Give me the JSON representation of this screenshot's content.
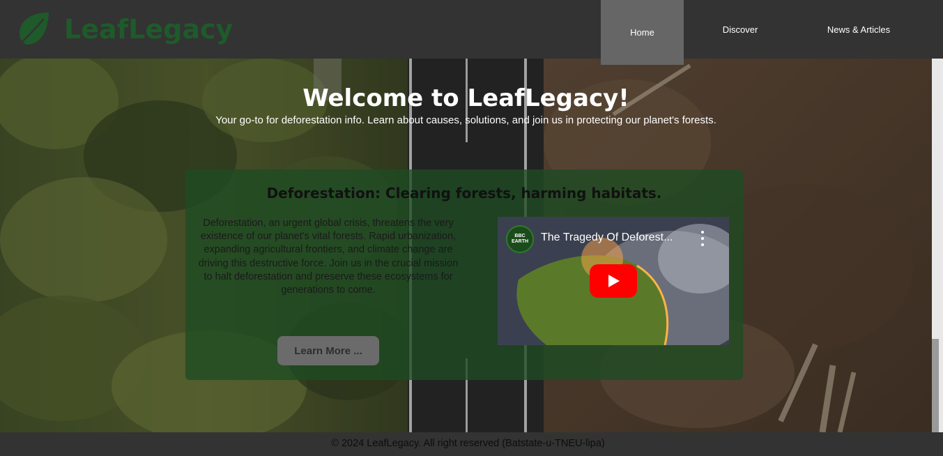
{
  "brand": {
    "name": "LeafLegacy",
    "logo_icon": "leaf-icon",
    "color": "#1e5a2a"
  },
  "nav": {
    "items": [
      {
        "label": "Home",
        "active": true
      },
      {
        "label": "Discover",
        "active": false
      },
      {
        "label": "News & Articles",
        "active": false
      }
    ]
  },
  "hero": {
    "title": "Welcome to LeafLegacy!",
    "subtitle": "Your go-to for deforestation info. Learn about causes, solutions, and join us in protecting our planet's forests."
  },
  "card": {
    "title": "Deforestation: Clearing forests, harming habitats.",
    "body": "Deforestation, an urgent global crisis, threatens the very existence of our planet's vital forests. Rapid urbanization, expanding agricultural frontiers, and climate change are driving this destructive force. Join us in the crucial mission to halt deforestation and preserve these ecosystems for generations to come.",
    "button_label": "Learn More ...",
    "video": {
      "channel_badge": "BBC EARTH",
      "title": "The Tragedy Of Deforest...",
      "play_icon": "youtube-play-icon",
      "menu_icon": "more-vert-icon"
    }
  },
  "footer": {
    "text": "© 2024 LeafLegacy. All right reserved (Batstate-u-TNEU-lipa)"
  },
  "colors": {
    "header_bg": "#333333",
    "active_nav_bg": "#666666",
    "card_bg": "#1e4b23"
  }
}
